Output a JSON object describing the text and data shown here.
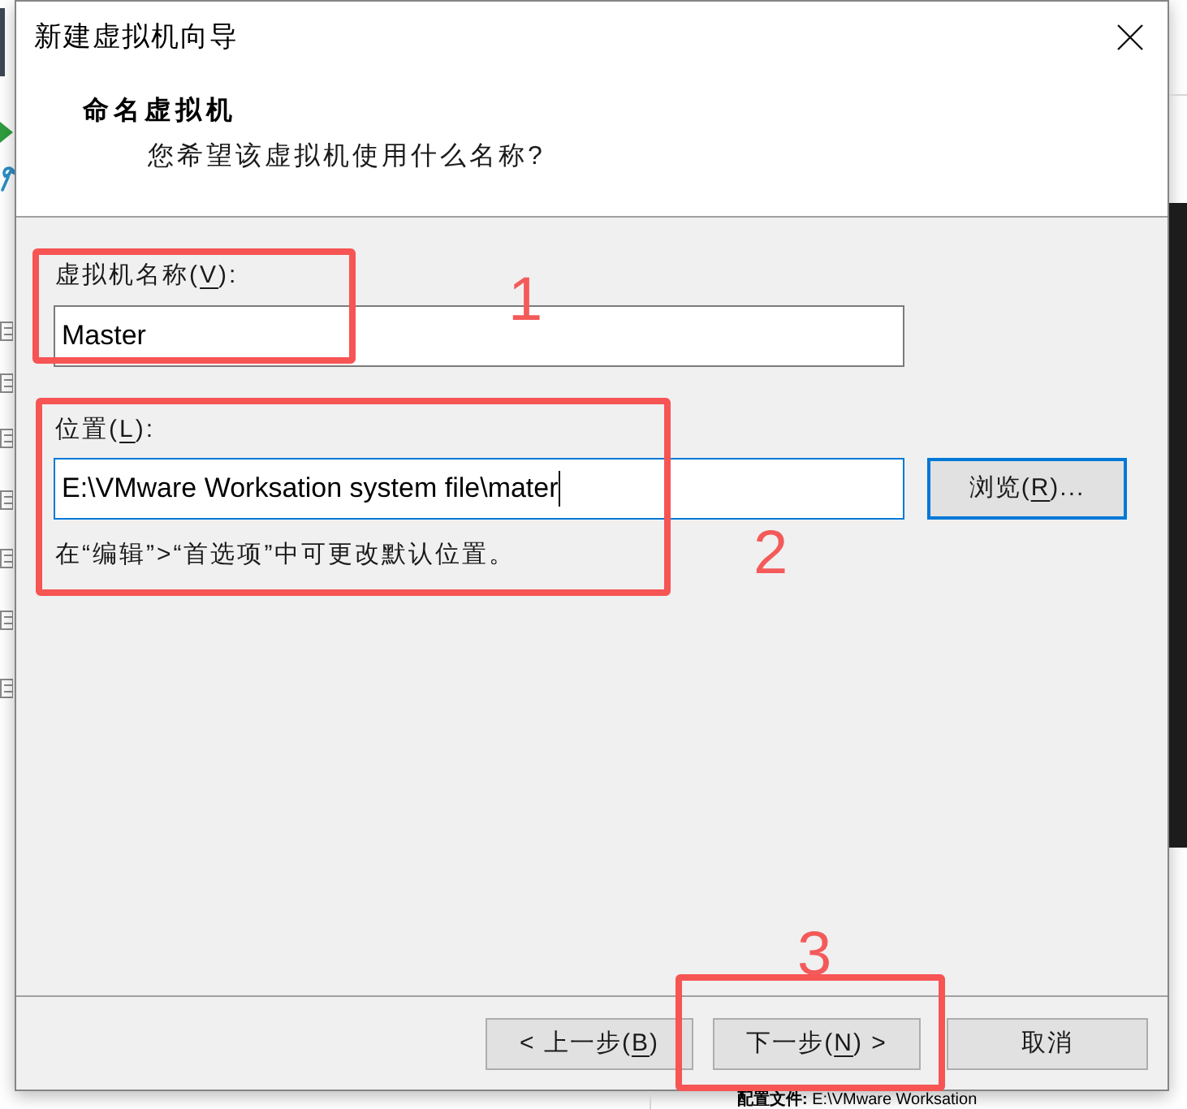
{
  "window": {
    "title": "新建虚拟机向导"
  },
  "header": {
    "title": "命名虚拟机",
    "subtitle": "您希望该虚拟机使用什么名称?"
  },
  "fields": [
    {
      "label": {
        "before": "虚拟机名称(",
        "access_key": "V",
        "after": "):"
      },
      "value": "Master",
      "focused": false
    },
    {
      "label": {
        "before": "位置(",
        "access_key": "L",
        "after": "):"
      },
      "value": "E:\\VMware Worksation system file\\mater",
      "focused": true,
      "browse_button": {
        "before": "浏览(",
        "access_key": "R",
        "after": ")...",
        "highlighted": true
      },
      "hint": "在“编辑”>“首选项”中可更改默认位置。"
    }
  ],
  "buttons": [
    {
      "before": "< 上一步(",
      "access_key": "B",
      "after": ")",
      "highlighted": false
    },
    {
      "before": "下一步(",
      "access_key": "N",
      "after": ") >",
      "highlighted": false
    },
    {
      "before": "取消",
      "highlighted": false
    }
  ],
  "annotations": [
    {
      "number": "1"
    },
    {
      "number": "2"
    },
    {
      "number": "3"
    }
  ],
  "background": {
    "status_text": "**配置文件:** E:\\VMware Worksation"
  }
}
